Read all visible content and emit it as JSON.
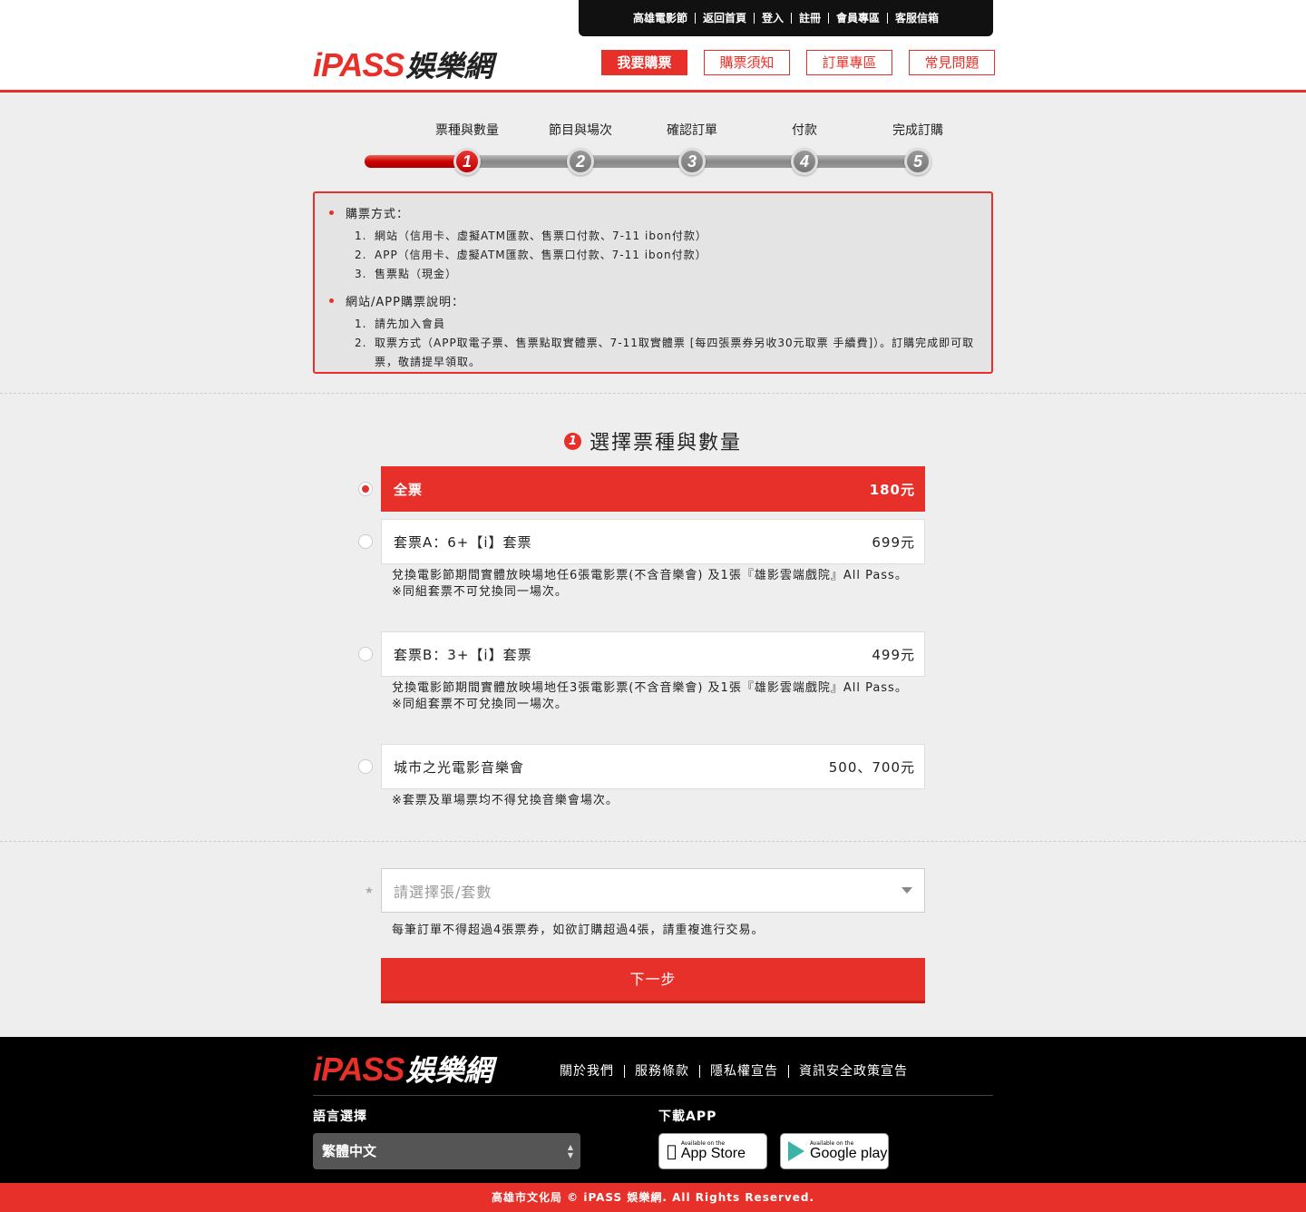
{
  "topbar": {
    "links": [
      "高雄電影節",
      "返回首頁",
      "登入",
      "註冊",
      "會員專區",
      "客服信箱"
    ]
  },
  "logo": {
    "i": "i",
    "pass": "PASS",
    "yule": "娛樂網"
  },
  "mainnav": [
    "我要購票",
    "購票須知",
    "訂單專區",
    "常見問題"
  ],
  "steps": {
    "labels": [
      "票種與數量",
      "節目與場次",
      "確認訂單",
      "付款",
      "完成訂購"
    ],
    "numbers": [
      "1",
      "2",
      "3",
      "4",
      "5"
    ],
    "current": 1
  },
  "notice": {
    "sec1_title": "購票方式：",
    "sec1_items": [
      {
        "n": "1.",
        "t": "網站（信用卡、虛擬ATM匯款、售票口付款、7-11 ibon付款）"
      },
      {
        "n": "2.",
        "t": "APP（信用卡、虛擬ATM匯款、售票口付款、7-11 ibon付款）"
      },
      {
        "n": "3.",
        "t": "售票點（現金）"
      }
    ],
    "sec2_title": "網站/APP購票說明：",
    "sec2_items": [
      {
        "n": "1.",
        "t": "請先加入會員"
      },
      {
        "n": "2.",
        "t": "取票方式（APP取電子票、售票點取實體票、7-11取實體票 [每四張票券另收30元取票 手續費]）。訂購完成即可取票，敬請提早領取。"
      }
    ]
  },
  "section": {
    "num": "1",
    "title": "選擇票種與數量"
  },
  "tickets": [
    {
      "name": "全票",
      "price": "180元",
      "desc": ""
    },
    {
      "name": "套票A：6+【i】套票",
      "price": "699元",
      "desc": "兌換電影節期間實體放映場地任6張電影票(不含音樂會) 及1張『雄影雲端戲院』All Pass。",
      "note": "※同組套票不可兌換同一場次。"
    },
    {
      "name": "套票B：3+【i】套票",
      "price": "499元",
      "desc": "兌換電影節期間實體放映場地任3張電影票(不含音樂會) 及1張『雄影雲端戲院』All Pass。",
      "note": "※同組套票不可兌換同一場次。"
    },
    {
      "name": "城市之光電影音樂會",
      "price": "500、700元",
      "desc": "※套票及單場票均不得兌換音樂會場次。"
    }
  ],
  "qty": {
    "star": "★",
    "placeholder": "請選擇張/套數",
    "note": "每筆訂單不得超過4張票券，如欲訂購超過4張，請重複進行交易。"
  },
  "next_label": "下一步",
  "footer": {
    "links": [
      "關於我們",
      "服務條款",
      "隱私權宣告",
      "資訊安全政策宣告"
    ],
    "lang_label": "語言選擇",
    "lang_value": "繁體中文",
    "app_label": "下載APP",
    "appstore_small": "Available on the",
    "appstore_big": "App Store",
    "gplay_small": "Available on the",
    "gplay_big": "Google play",
    "copyright": "高雄市文化局 © iPASS 娛樂網. All Rights Reserved."
  },
  "colors": {
    "brand": "#e8302a",
    "footer": "#000000"
  }
}
